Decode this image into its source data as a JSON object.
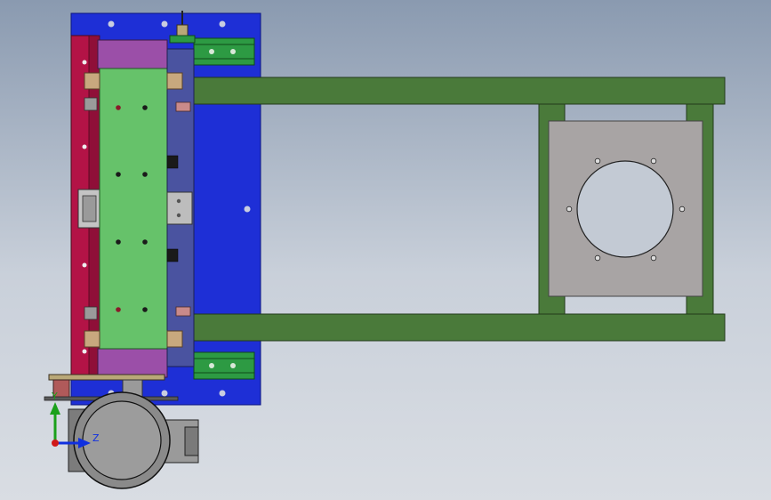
{
  "viewport": {
    "background_top": "#8a9ab0",
    "background_bottom": "#d9dde3"
  },
  "triad": {
    "y_label": "Y",
    "z_label": "Z",
    "y_color": "#1aa01a",
    "z_color": "#1030e0",
    "origin_color": "#d01818"
  },
  "colors": {
    "base_plate": "#1e2fd6",
    "frame": "#4a7a3a",
    "side_plate": "#b31346",
    "center_block": "#66c26a",
    "purple_block": "#9b4fa8",
    "slate_bar": "#4a53a0",
    "motor_plate": "#a8a4a4",
    "motor_body": "#8a8a8a"
  }
}
